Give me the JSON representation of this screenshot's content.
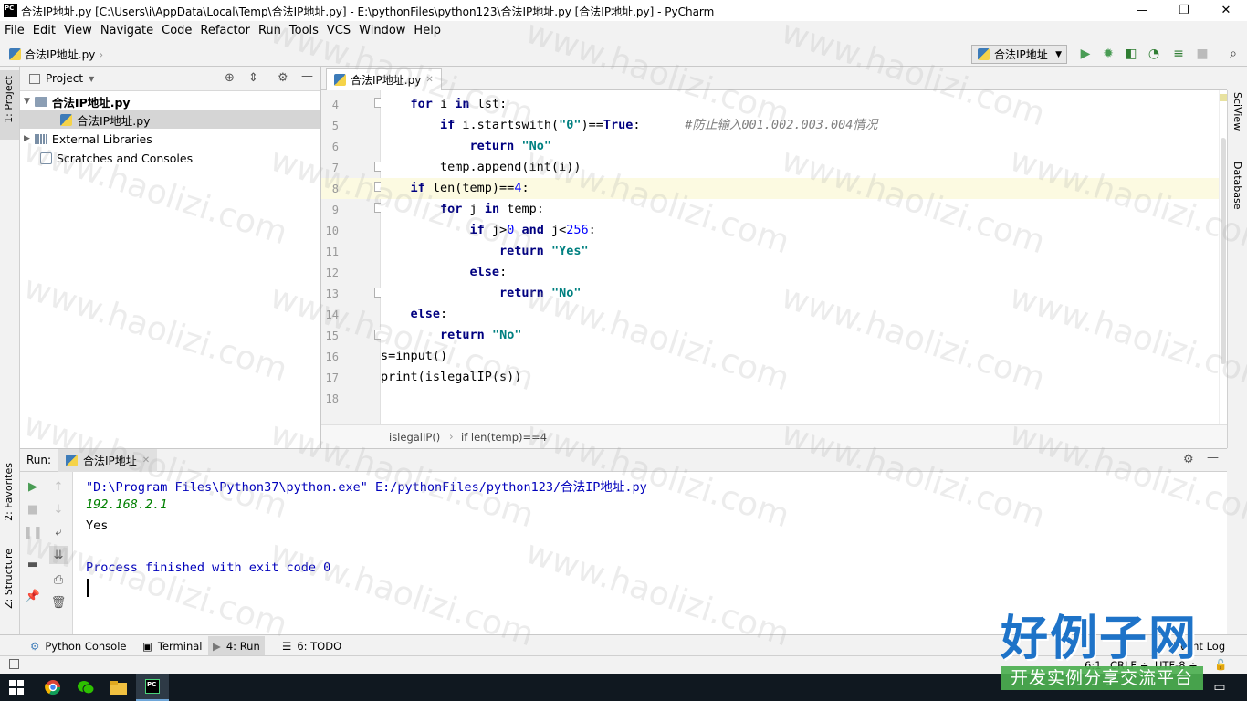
{
  "window": {
    "title": "合法IP地址.py [C:\\Users\\i\\AppData\\Local\\Temp\\合法IP地址.py] - E:\\pythonFiles\\python123\\合法IP地址.py [合法IP地址.py] - PyCharm",
    "minimize": "—",
    "maximize": "❐",
    "close": "✕"
  },
  "menu": [
    "File",
    "Edit",
    "View",
    "Navigate",
    "Code",
    "Refactor",
    "Run",
    "Tools",
    "VCS",
    "Window",
    "Help"
  ],
  "nav": {
    "crumb": "合法IP地址.py",
    "run_config": "合法IP地址"
  },
  "left_strip": {
    "project": "1: Project",
    "favorites": "2: Favorites",
    "structure": "Z: Structure"
  },
  "right_strip": {
    "sciview": "SciView",
    "database": "Database"
  },
  "project": {
    "header": "Project",
    "items": [
      {
        "label": "合法IP地址.py",
        "type": "root"
      },
      {
        "label": "合法IP地址.py",
        "type": "file"
      },
      {
        "label": "External Libraries",
        "type": "libs"
      },
      {
        "label": "Scratches and Consoles",
        "type": "scratch"
      }
    ]
  },
  "editor": {
    "tab": "合法IP地址.py",
    "line_numbers": [
      "4",
      "5",
      "6",
      "7",
      "8",
      "9",
      "10",
      "11",
      "12",
      "13",
      "14",
      "15",
      "16",
      "17",
      "18"
    ],
    "highlighted_line": 8,
    "breadcrumb": [
      "islegalIP()",
      "if len(temp)==4"
    ]
  },
  "run": {
    "label": "Run:",
    "tab": "合法IP地址",
    "output": [
      {
        "text": "\"D:\\Program Files\\Python37\\python.exe\" E:/pythonFiles/python123/合法IP地址.py",
        "kind": "cmd"
      },
      {
        "text": "192.168.2.1",
        "kind": "input"
      },
      {
        "text": "Yes",
        "kind": "stdout"
      },
      {
        "text": "",
        "kind": "stdout"
      },
      {
        "text": "Process finished with exit code 0",
        "kind": "sys"
      }
    ]
  },
  "bottom_tabs": [
    "Python Console",
    "Terminal",
    "4: Run",
    "6: TODO"
  ],
  "status": {
    "event_log": "Event Log",
    "position": "6:1",
    "line_sep": "CRLF ÷",
    "encoding": "UTF-8 ÷"
  },
  "watermark": "www.haolizi.com",
  "logo": {
    "main": "好例子网",
    "sub": "开发实例分享交流平台"
  },
  "colors": {
    "keyword": "#000080",
    "string": "#008080",
    "number": "#0000ff",
    "comment": "#808080",
    "run_green": "#499c54",
    "input_green": "#008000"
  }
}
